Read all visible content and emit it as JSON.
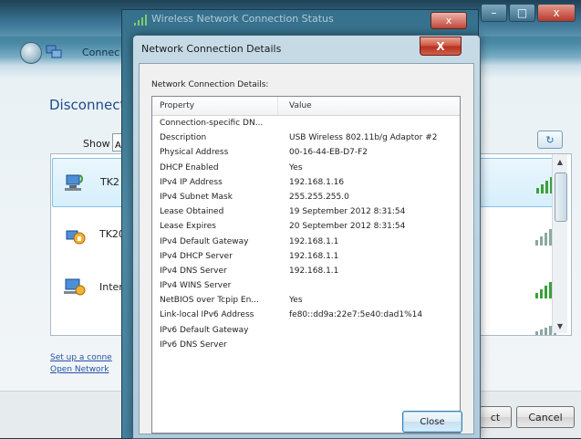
{
  "background_window": {
    "nav_title": "Connec",
    "heading": "Disconnect",
    "show_label": "Show",
    "show_value": "A",
    "networks": [
      {
        "name": "TK2",
        "icon": "wireless-network-icon",
        "selected": true
      },
      {
        "name": "TK20",
        "icon": "wireless-security-network-icon",
        "selected": false
      },
      {
        "name": "Inter",
        "icon": "internet-network-icon",
        "selected": false
      }
    ],
    "refresh_glyph": "↻",
    "links": [
      "Set up a conne",
      "Open Network"
    ],
    "buttons": {
      "connect_partial": "ct",
      "cancel": "Cancel"
    },
    "controls": {
      "minimize": "–",
      "maximize": "□",
      "close": "x"
    }
  },
  "status_window": {
    "title": "Wireless Network Connection Status",
    "close_glyph": "x"
  },
  "dialog": {
    "title": "Network Connection Details",
    "close_glyph": "X",
    "heading": "Network Connection Details:",
    "columns": [
      "Property",
      "Value"
    ],
    "rows": [
      {
        "property": "Connection-specific DN...",
        "value": ""
      },
      {
        "property": "Description",
        "value": "USB Wireless 802.11b/g Adaptor #2"
      },
      {
        "property": "Physical Address",
        "value": "00-16-44-EB-D7-F2"
      },
      {
        "property": "DHCP Enabled",
        "value": "Yes"
      },
      {
        "property": "IPv4 IP Address",
        "value": "192.168.1.16"
      },
      {
        "property": "IPv4 Subnet Mask",
        "value": "255.255.255.0"
      },
      {
        "property": "Lease Obtained",
        "value": "19 September 2012 8:31:54"
      },
      {
        "property": "Lease Expires",
        "value": "20 September 2012 8:31:54"
      },
      {
        "property": "IPv4 Default Gateway",
        "value": "192.168.1.1"
      },
      {
        "property": "IPv4 DHCP Server",
        "value": "192.168.1.1"
      },
      {
        "property": "IPv4 DNS Server",
        "value": "192.168.1.1"
      },
      {
        "property": "IPv4 WINS Server",
        "value": ""
      },
      {
        "property": "NetBIOS over Tcpip En...",
        "value": "Yes"
      },
      {
        "property": "Link-local IPv6 Address",
        "value": "fe80::dd9a:22e7:5e40:dad1%14"
      },
      {
        "property": "IPv6 Default Gateway",
        "value": ""
      },
      {
        "property": "IPv6 DNS Server",
        "value": ""
      }
    ],
    "close_button": "Close"
  },
  "colors": {
    "accent_green": "#3aa03a",
    "link_blue": "#2253a6",
    "close_red": "#c3473a"
  }
}
